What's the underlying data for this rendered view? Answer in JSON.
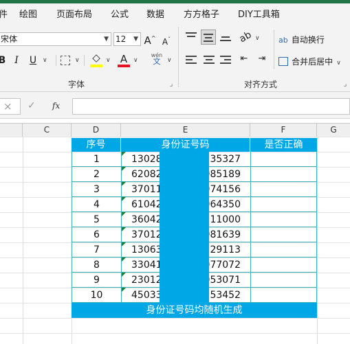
{
  "menu": [
    "绘图",
    "页面布局",
    "公式",
    "数据",
    "方方格子",
    "DIY工具箱"
  ],
  "ribbon": {
    "font_name": "宋体",
    "font_size": "12",
    "grow_font": "A",
    "shrink_font": "A",
    "bold": "B",
    "italic": "I",
    "underline": "U",
    "font_color_letter": "A",
    "phonetic_top": "wén",
    "phonetic_bottom": "文",
    "font_group_label": "字体",
    "wrap_text": "自动换行",
    "merge_center": "合并后居中",
    "align_group_label": "对齐方式",
    "wrap_glyph": "ab",
    "colors": {
      "highlight": "#ffff00",
      "font_color": "#e81123",
      "accent": "#217346"
    }
  },
  "formula_bar": {
    "cancel": "×",
    "enter": "✓",
    "fx": "fx",
    "value": ""
  },
  "columns": [
    "C",
    "D",
    "E",
    "F",
    "G"
  ],
  "table": {
    "headers": [
      "序号",
      "身份证号码",
      "是否正确"
    ],
    "rows": [
      {
        "n": "1",
        "id_start": "13028",
        "id_end": "35327"
      },
      {
        "n": "2",
        "id_start": "62082",
        "id_end": "085189"
      },
      {
        "n": "3",
        "id_start": "37011",
        "id_end": "074156"
      },
      {
        "n": "4",
        "id_start": "61042",
        "id_end": "064350"
      },
      {
        "n": "5",
        "id_start": "36042",
        "id_end": "11000"
      },
      {
        "n": "6",
        "id_start": "37012",
        "id_end": "081639"
      },
      {
        "n": "7",
        "id_start": "13063",
        "id_end": "229113"
      },
      {
        "n": "8",
        "id_start": "33041",
        "id_end": "077072"
      },
      {
        "n": "9",
        "id_start": "23012",
        "id_end": "053071"
      },
      {
        "n": "10",
        "id_start": "45033",
        "id_end": "53452"
      }
    ],
    "footer": "身份证号码均随机生成",
    "colors": {
      "header_bg": "#00a7e6",
      "mask": "#00a7e6",
      "border": "#3bb3b3"
    }
  }
}
